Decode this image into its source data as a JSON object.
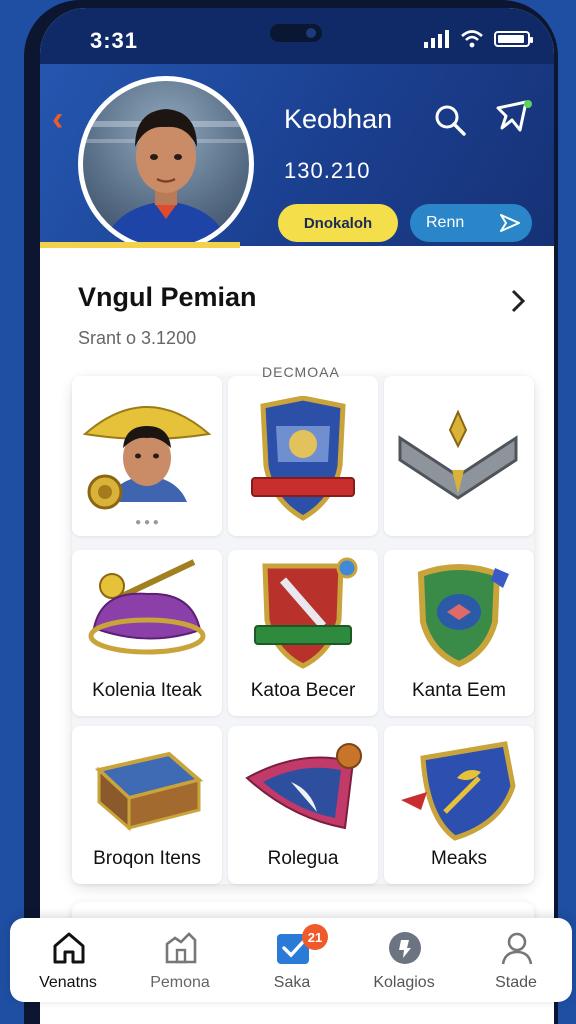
{
  "status_bar": {
    "time": "3:31"
  },
  "header": {
    "title": "Keobhan",
    "score": "130.210",
    "yellow_button": "Dnokaloh",
    "blue_button": "Renn",
    "accent_color": "#f4df4a"
  },
  "section": {
    "title": "Vngul Pemian",
    "subtitle": "Srant o 3.1200",
    "grid_header": "DECMOAA"
  },
  "grid_items": [
    {
      "label": "",
      "icon": "player-with-hat-icon"
    },
    {
      "label": "",
      "icon": "crest-shield-icon"
    },
    {
      "label": "",
      "icon": "chevron-rank-icon"
    },
    {
      "label": "Kolenia Iteak",
      "icon": "purple-bag-icon"
    },
    {
      "label": "Katoa Becer",
      "icon": "red-shield-icon"
    },
    {
      "label": "Kanta Eem",
      "icon": "green-shield-icon"
    },
    {
      "label": "Broqon Itens",
      "icon": "treasure-box-icon"
    },
    {
      "label": "Rolegua",
      "icon": "pennant-icon"
    },
    {
      "label": "Meaks",
      "icon": "blue-badge-icon"
    }
  ],
  "tabs": [
    {
      "label": "Venatns",
      "icon": "home-icon",
      "active": true
    },
    {
      "label": "Pemona",
      "icon": "building-icon",
      "active": false
    },
    {
      "label": "Saka",
      "icon": "check-box-icon",
      "active": false,
      "badge": "21"
    },
    {
      "label": "Kolagios",
      "icon": "coin-icon",
      "active": false
    },
    {
      "label": "Stade",
      "icon": "profile-icon",
      "active": false
    }
  ]
}
